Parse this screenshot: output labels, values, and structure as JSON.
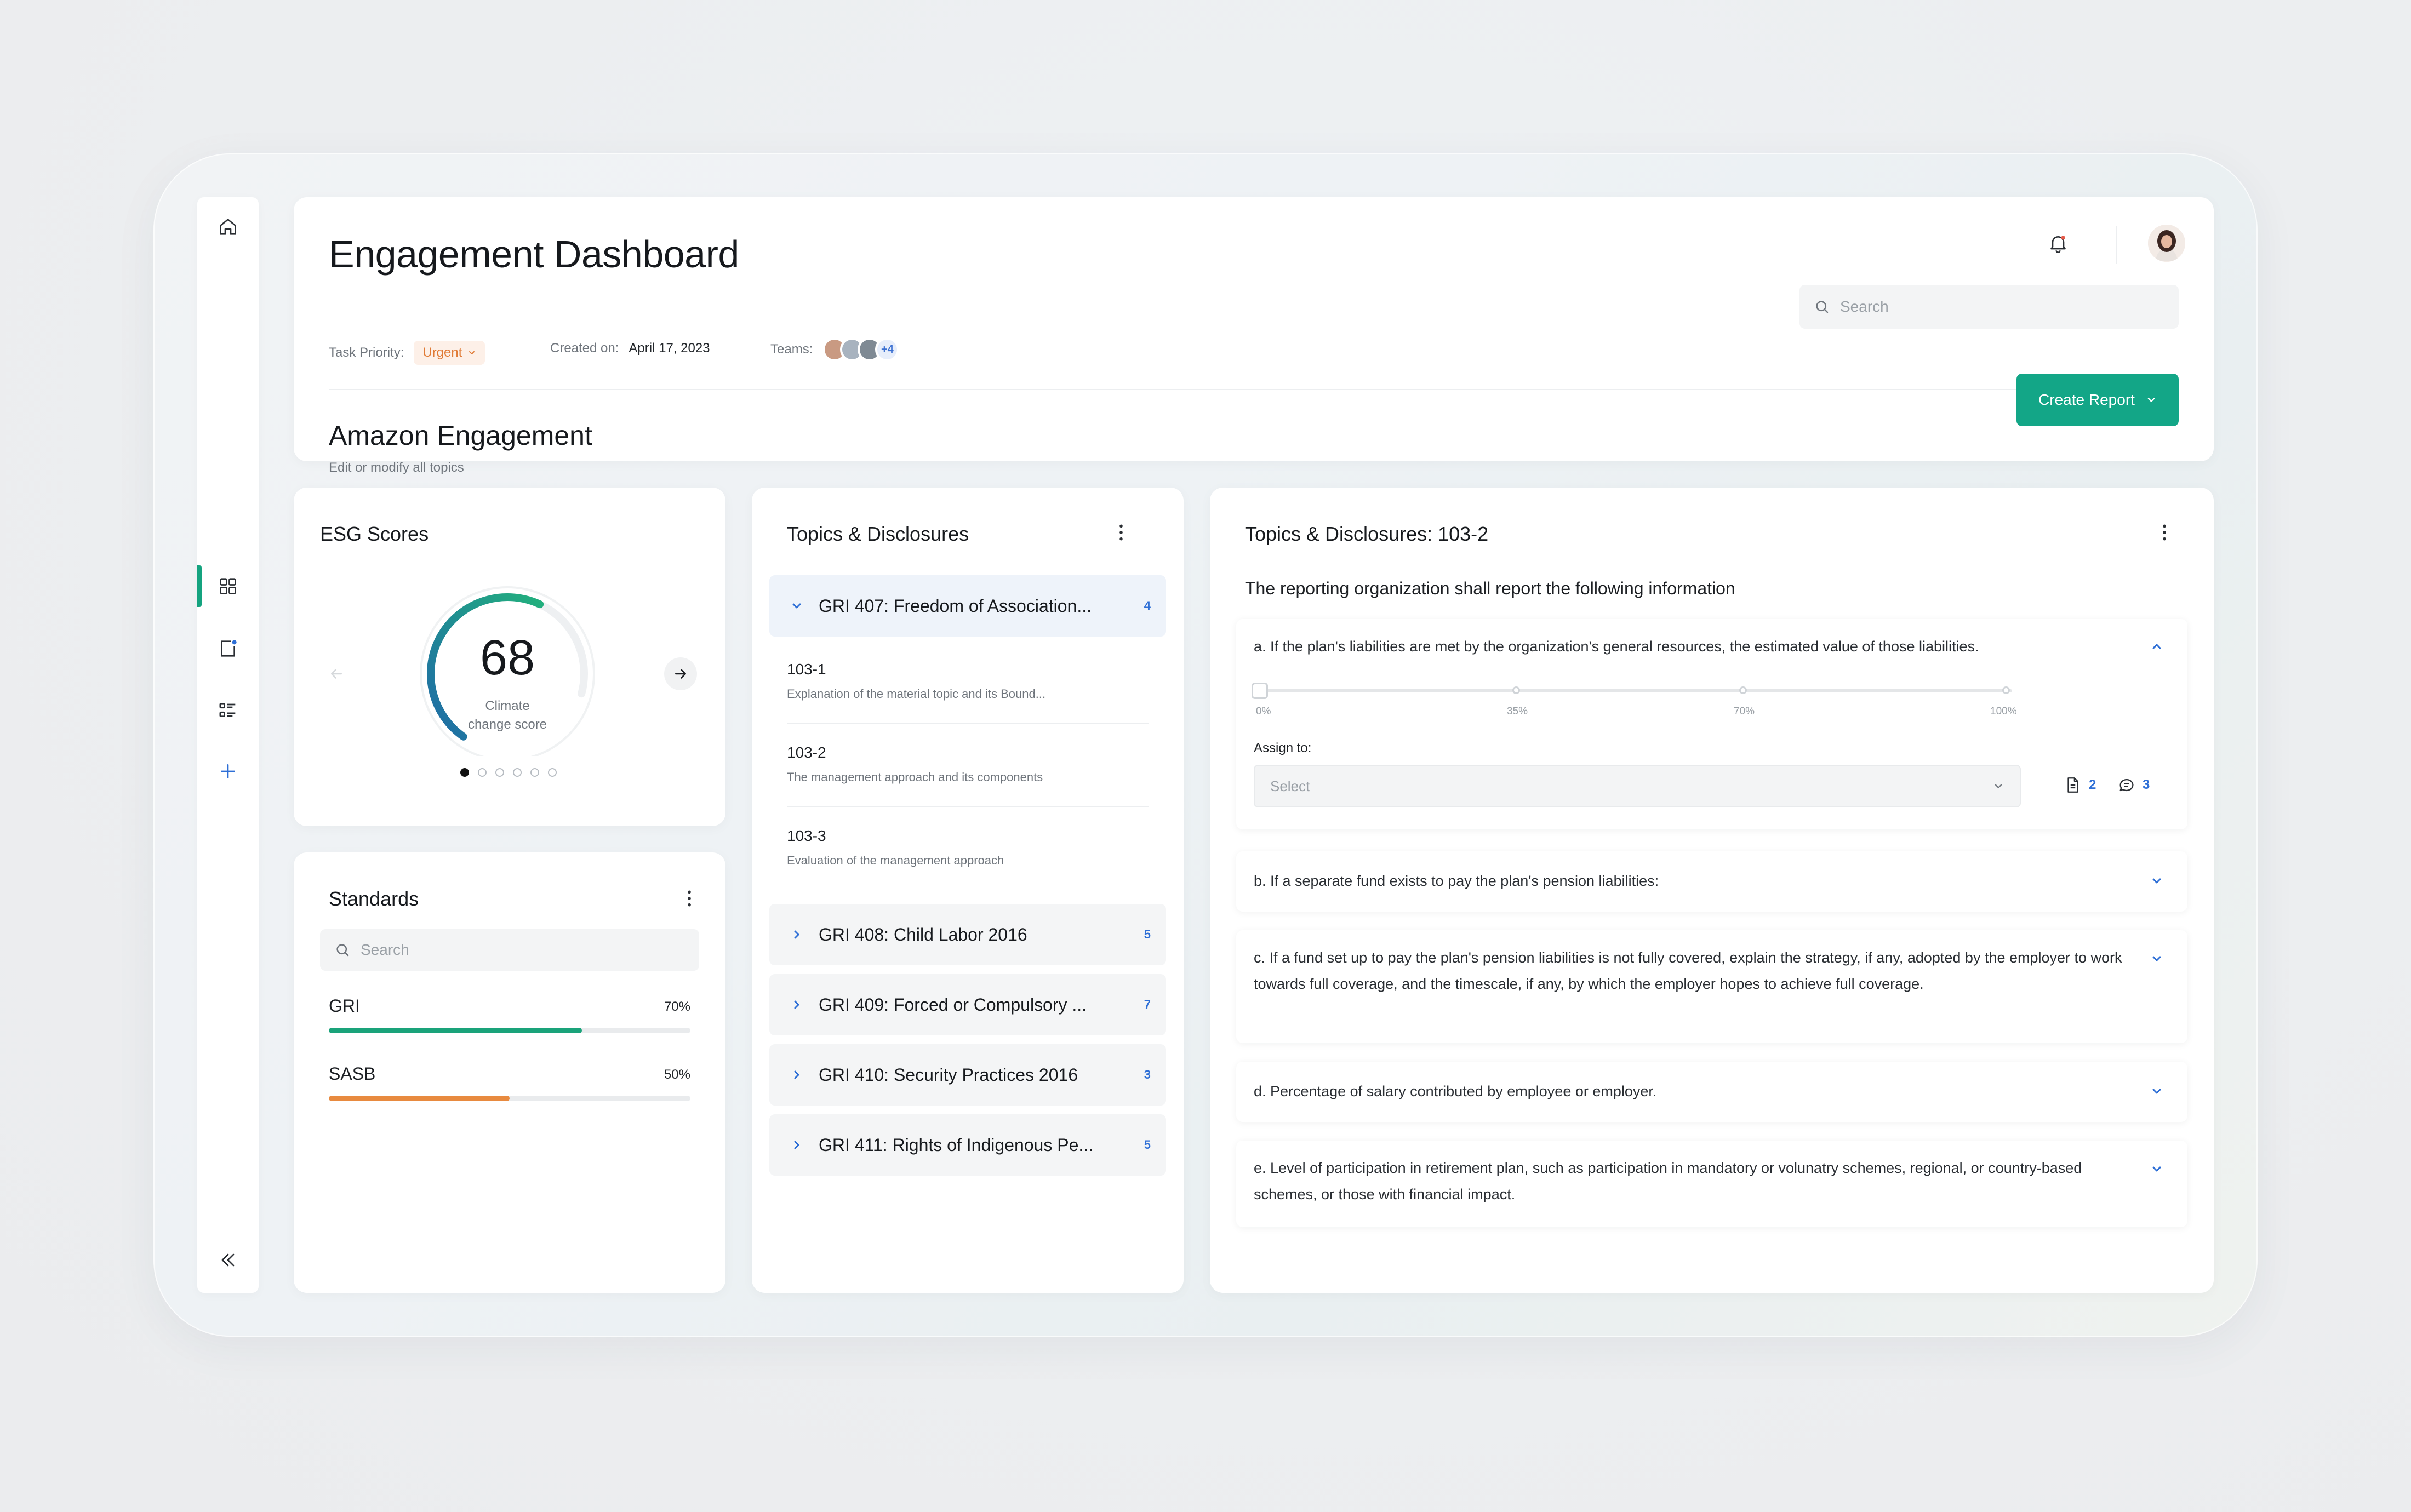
{
  "header": {
    "title": "Engagement Dashboard",
    "task_priority_label": "Task Priority:",
    "task_priority_value": "Urgent",
    "created_label": "Created on:",
    "created_value": "April 17, 2023",
    "teams_label": "Teams:",
    "teams_more": "+4",
    "search_placeholder": "Search",
    "engagement_title": "Amazon Engagement",
    "engagement_desc": "Edit or modify all topics",
    "create_report_label": "Create Report"
  },
  "esg": {
    "title": "ESG Scores",
    "score": "68",
    "score_label_line1": "Climate",
    "score_label_line2": "change score",
    "score_fraction": 0.68,
    "active_dot": 0,
    "dot_count": 6
  },
  "standards": {
    "title": "Standards",
    "search_placeholder": "Search",
    "items": [
      {
        "name": "GRI",
        "percent_label": "70%",
        "value": 0.7,
        "color": "#1aa37a"
      },
      {
        "name": "SASB",
        "percent_label": "50%",
        "value": 0.5,
        "color": "#e88a3f"
      }
    ]
  },
  "topics": {
    "title": "Topics & Disclosures",
    "groups": [
      {
        "name": "GRI 407: Freedom of Association...",
        "count": "4",
        "open": true
      },
      {
        "name": "GRI 408: Child Labor 2016",
        "count": "5",
        "open": false
      },
      {
        "name": "GRI 409: Forced or Compulsory ...",
        "count": "7",
        "open": false
      },
      {
        "name": "GRI 410: Security Practices 2016",
        "count": "3",
        "open": false
      },
      {
        "name": "GRI 411: Rights of Indigenous Pe...",
        "count": "5",
        "open": false
      }
    ],
    "sub_items": [
      {
        "code": "103-1",
        "text": "Explanation of the material topic and its Bound..."
      },
      {
        "code": "103-2",
        "text": "The management approach and its components"
      },
      {
        "code": "103-3",
        "text": "Evaluation of the management approach"
      }
    ]
  },
  "detail": {
    "title": "Topics & Disclosures: 103-2",
    "intro": "The reporting organization shall report the following information",
    "questions": [
      {
        "text": "a. If the plan's liabilities are met by the organization's general resources, the estimated value of those liabilities.",
        "expanded": true
      },
      {
        "text": "b. If a separate fund exists to pay the plan's pension liabilities:",
        "expanded": false
      },
      {
        "text": "c. If a fund set up to pay the plan's pension liabilities is not fully covered, explain the strategy, if any, adopted by the employer to work towards full coverage, and the timescale, if any, by which the employer hopes to achieve full coverage.",
        "expanded": false
      },
      {
        "text": "d. Percentage of salary contributed by employee or employer.",
        "expanded": false
      },
      {
        "text": "e. Level of participation in retirement plan, such as participation in mandatory or volunatry schemes, regional, or country-based schemes, or those with financial impact.",
        "expanded": false
      }
    ],
    "slider": {
      "value": 0,
      "labels": [
        "0%",
        "35%",
        "70%",
        "100%"
      ]
    },
    "assign_label": "Assign to:",
    "select_placeholder": "Select",
    "attachments_count": "2",
    "comments_count": "3"
  },
  "colors": {
    "accent": "#13a687",
    "link": "#2e6fd6",
    "urgent": "#e07a35"
  }
}
